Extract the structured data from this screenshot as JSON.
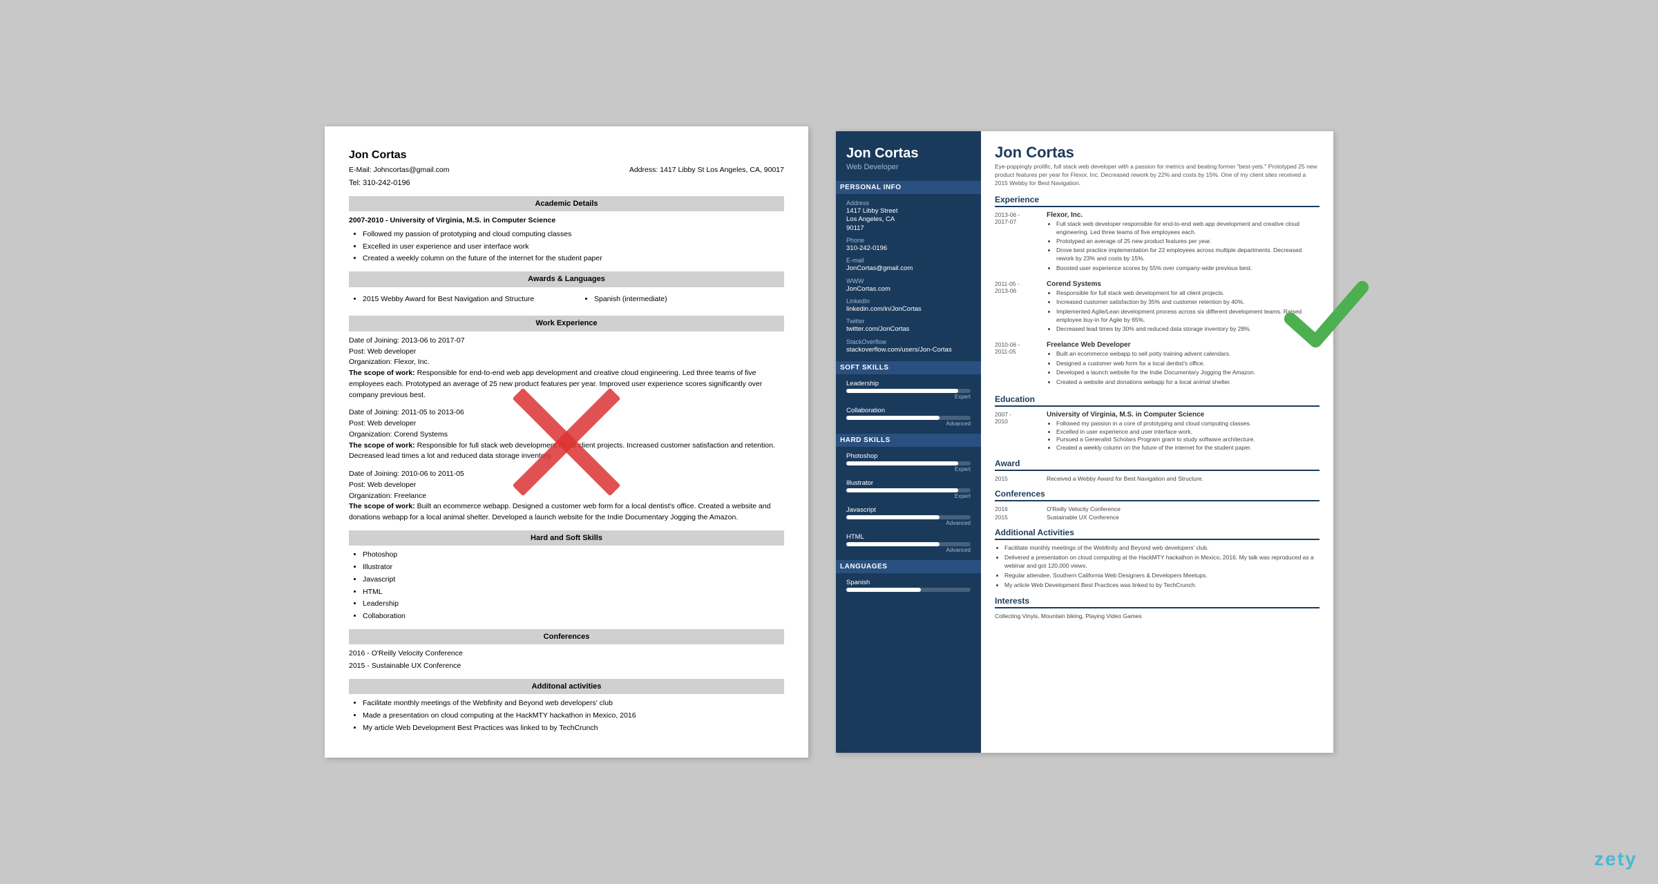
{
  "page": {
    "background": "#c8c8c8",
    "brand": "zety"
  },
  "left_resume": {
    "name": "Jon Cortas",
    "email": "E-Mail: Johncortas@gmail.com",
    "tel": "Tel: 310-242-0196",
    "address_label": "Address:",
    "address": "1417 Libby St Los Angeles, CA, 90017",
    "sections": {
      "academic": {
        "title": "Academic Details",
        "entry": "2007-2010 - University of Virginia, M.S. in Computer Science",
        "bullets": [
          "Followed my passion of prototyping and cloud computing classes",
          "Excelled in user experience and user interface work",
          "Created a weekly column on the future of the internet for the student paper"
        ]
      },
      "awards": {
        "title": "Awards & Languages",
        "item1": "2015 Webby Award for Best Navigation and Structure",
        "item2": "Spanish (intermediate)"
      },
      "work": {
        "title": "Work Experience",
        "entries": [
          {
            "date": "Date of Joining: 2013-06 to 2017-07",
            "post": "Post: Web developer",
            "org": "Organization: Flexor, Inc.",
            "scope_label": "The scope of work:",
            "scope": "Responsible for end-to-end web app development and creative cloud engineering. Led three teams of five employees each. Prototyped an average of 25 new product features per year. Improved user experience scores significantly over company previous best."
          },
          {
            "date": "Date of Joining: 2011-05 to 2013-06",
            "post": "Post: Web developer",
            "org": "Organization: Corend Systems",
            "scope_label": "The scope of work:",
            "scope": "Responsible for full stack web development for all client projects. Increased customer satisfaction and retention. Decreased lead times a lot and reduced data storage inventory."
          },
          {
            "date": "Date of Joining: 2010-06 to 2011-05",
            "post": "Post: Web developer",
            "org": "Organization: Freelance",
            "scope_label": "The scope of work:",
            "scope": "Built an ecommerce webapp. Designed a customer web form for a local dentist's office. Created a website and donations webapp for a local animal shelter. Developed a launch website for the Indie Documentary Jogging the Amazon."
          }
        ]
      },
      "skills": {
        "title": "Hard and Soft Skills",
        "items": [
          "Photoshop",
          "Illustrator",
          "Javascript",
          "HTML",
          "Leadership",
          "Collaboration"
        ]
      },
      "conferences": {
        "title": "Conferences",
        "items": [
          "2016 - O'Reilly Velocity Conference",
          "2015 - Sustainable UX Conference"
        ]
      },
      "activities": {
        "title": "Additonal activities",
        "items": [
          "Facilitate monthly meetings of the Webfinity and Beyond web developers' club",
          "Made a presentation on cloud computing at the HackMTY hackathon in Mexico, 2016",
          "My article Web Development Best Practices was linked to by TechCrunch"
        ]
      }
    }
  },
  "right_resume": {
    "sidebar": {
      "name": "Jon Cortas",
      "title": "Web Developer",
      "personal_info_title": "Personal Info",
      "address_label": "Address",
      "address": "1417 Libby Street\nLos Angeles, CA\n90117",
      "phone_label": "Phone",
      "phone": "310-242-0196",
      "email_label": "E-mail",
      "email": "JonCortas@gmail.com",
      "www_label": "WWW",
      "www": "JonCortas.com",
      "linkedin_label": "LinkedIn",
      "linkedin": "linkedin.com/in/JonCortas",
      "twitter_label": "Twitter",
      "twitter": "twitter.com/JonCortas",
      "stackoverflow_label": "StackOverflow",
      "stackoverflow": "stackoverflow.com/users/Jon-Cortas",
      "soft_skills_title": "Soft Skills",
      "skills": [
        {
          "name": "Leadership",
          "level": 90,
          "label": "Expert"
        },
        {
          "name": "Collaboration",
          "level": 75,
          "label": "Advanced"
        }
      ],
      "hard_skills_title": "Hard Skills",
      "hard_skills": [
        {
          "name": "Photoshop",
          "level": 90,
          "label": "Expert"
        },
        {
          "name": "Illustrator",
          "level": 90,
          "label": "Expert"
        },
        {
          "name": "Javascript",
          "level": 75,
          "label": "Advanced"
        },
        {
          "name": "HTML",
          "level": 75,
          "label": "Advanced"
        }
      ],
      "languages_title": "Languages",
      "languages": [
        {
          "name": "Spanish",
          "level": 60,
          "label": ""
        }
      ]
    },
    "main": {
      "name": "Jon Cortas",
      "tagline": "Eye-poppingly prolific, full stack web developer with a passion for metrics and beating former \"best-yets.\" Prototyped 25 new product features per year for Flexor, Inc. Decreased rework by 22% and costs by 15%. One of my client sites received a 2015 Webby for Best Navigation.",
      "experience_title": "Experience",
      "experiences": [
        {
          "date": "2013-06 -\n2017-07",
          "company": "Flexor, Inc.",
          "bullets": [
            "Full stack web developer responsible for end-to-end web app development and creative cloud engineering. Led three teams of five employees each.",
            "Prototyped an average of 25 new product features per year.",
            "Drove best practice implementation for 22 employees across multiple departments. Decreased rework by 23% and costs by 15%.",
            "Boosted user experience scores by 55% over company-wide previous best."
          ]
        },
        {
          "date": "2011-05 -\n2013-06",
          "company": "Corend Systems",
          "bullets": [
            "Responsible for full stack web development for all client projects.",
            "Increased customer satisfaction by 35% and customer retention by 40%.",
            "Implemented Agile/Lean development process across six different development teams. Raised employee buy-in for Agile by 65%.",
            "Decreased lead times by 30% and reduced data storage inventory by 28%."
          ]
        },
        {
          "date": "2010-06 -\n2011-05",
          "company": "Freelance Web Developer",
          "bullets": [
            "Built an ecommerce webapp to sell potty training advent calendars.",
            "Designed a customer web form for a local dentist's office.",
            "Developed a launch website for the Indie Documentary Jogging the Amazon.",
            "Created a website and donations webapp for a local animal shelter."
          ]
        }
      ],
      "education_title": "Education",
      "education": [
        {
          "date": "2007 -\n2010",
          "school": "University of Virginia, M.S. in Computer Science",
          "bullets": [
            "Followed my passion in a core of prototyping and cloud computing classes.",
            "Excelled in user experience and user interface work.",
            "Pursued a Generalist Scholars Program grant to study software architecture.",
            "Created a weekly column on the future of the internet for the student paper."
          ]
        }
      ],
      "award_title": "Award",
      "awards": [
        {
          "year": "2015",
          "desc": "Received a Webby Award for Best Navigation and Structure."
        }
      ],
      "conferences_title": "Conferences",
      "conferences": [
        {
          "year": "2016",
          "name": "O'Reilly Velocity Conference"
        },
        {
          "year": "2015",
          "name": "Sustainable UX Conference"
        }
      ],
      "activities_title": "Additional Activities",
      "activities": [
        "Facilitate monthly meetings of the Webfinity and Beyond web developers' club.",
        "Delivered a presentation on cloud computing at the HackMTY hackathon in Mexico, 2016. My talk was reproduced as a webinar and got 120,000 views.",
        "Regular attendee, Southern California Web Designers & Developers Meetups.",
        "My article Web Development Best Practices was linked to by TechCrunch."
      ],
      "interests_title": "Interests",
      "interests": "Collecting Vinyls, Mountain biking, Playing Video Games"
    }
  }
}
